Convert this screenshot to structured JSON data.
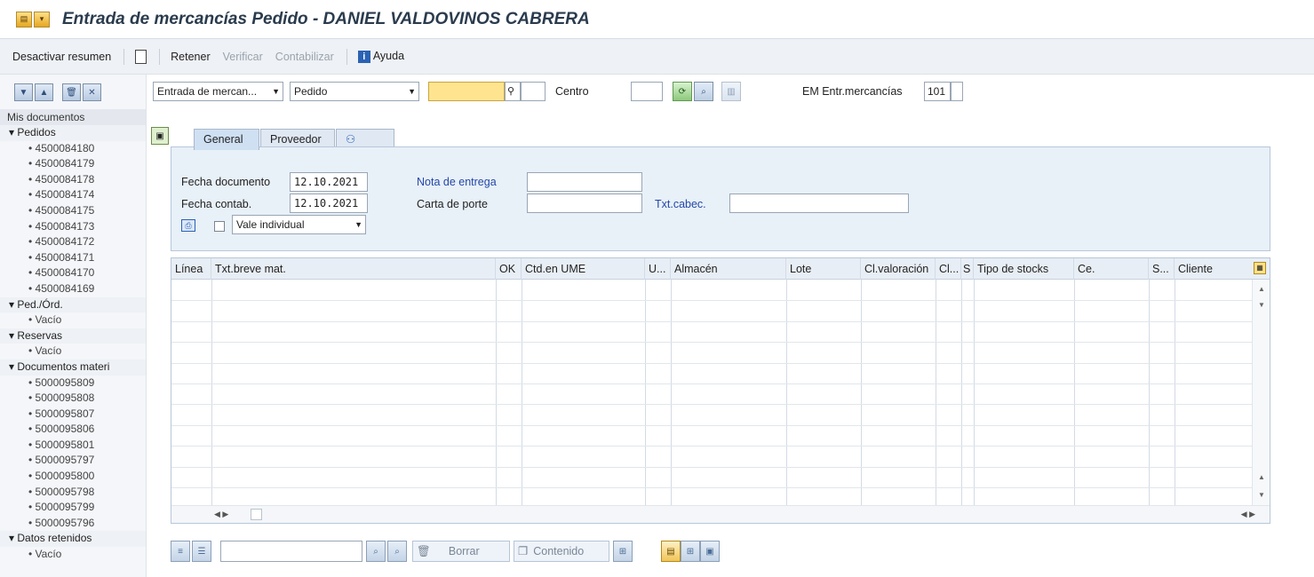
{
  "window": {
    "title": "Entrada de mercancías Pedido - DANIEL VALDOVINOS CABRERA",
    "title_icons": [
      "menu-icon",
      "dropdown-icon"
    ]
  },
  "toolbar": {
    "desactivar_resumen": "Desactivar resumen",
    "retener": "Retener",
    "verificar": "Verificar",
    "contabilizar": "Contabilizar",
    "ayuda": "Ayuda"
  },
  "sidebar": {
    "header": "Mis documentos",
    "pedidos": {
      "label": "Pedidos",
      "items": [
        "4500084180",
        "4500084179",
        "4500084178",
        "4500084174",
        "4500084175",
        "4500084173",
        "4500084172",
        "4500084171",
        "4500084170",
        "4500084169"
      ]
    },
    "ped_ord": {
      "label": "Ped./Órd.",
      "items": [
        "Vacío"
      ]
    },
    "reservas": {
      "label": "Reservas",
      "items": [
        "Vacío"
      ]
    },
    "documentos_material": {
      "label": "Documentos materi",
      "items": [
        "5000095809",
        "5000095808",
        "5000095807",
        "5000095806",
        "5000095801",
        "5000095797",
        "5000095800",
        "5000095798",
        "5000095799",
        "5000095796"
      ]
    },
    "datos_retenidos": {
      "label": "Datos retenidos",
      "items": [
        "Vacío"
      ]
    }
  },
  "selector": {
    "transaction": "Entrada de mercan...",
    "reference": "Pedido",
    "order_value": "",
    "centro_label": "Centro",
    "centro_value": "",
    "em_label": "EM Entr.mercancías",
    "em_value": "101"
  },
  "tabs": [
    "General",
    "Proveedor",
    "⚇"
  ],
  "header_form": {
    "fecha_documento_label": "Fecha documento",
    "fecha_documento": "12.10.2021",
    "fecha_contab_label": "Fecha contab.",
    "fecha_contab": "12.10.2021",
    "nota_entrega_label": "Nota de entrega",
    "nota_entrega": "",
    "carta_porte_label": "Carta de porte",
    "carta_porte": "",
    "txt_cabec_label": "Txt.cabec.",
    "txt_cabec": "",
    "vale_option": "Vale individual"
  },
  "table": {
    "columns": [
      "Línea",
      "Txt.breve mat.",
      "OK",
      "Ctd.en UME",
      "U...",
      "Almacén",
      "Lote",
      "Cl.valoración",
      "Cl...",
      "S",
      "Tipo de stocks",
      "Ce.",
      "S...",
      "Cliente"
    ],
    "rows": []
  },
  "bottom_toolbar": {
    "search_value": "",
    "borrar": "Borrar",
    "contenido": "Contenido"
  }
}
